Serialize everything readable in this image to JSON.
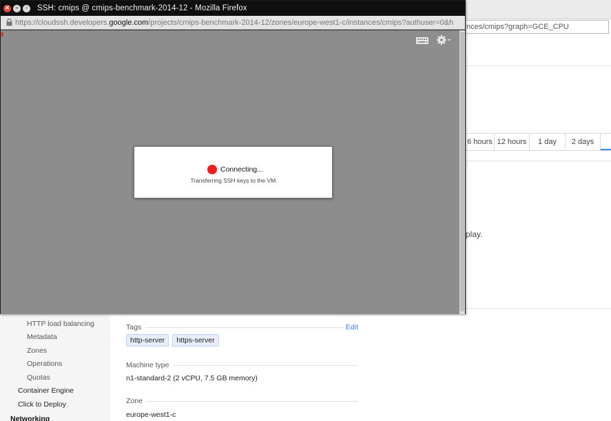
{
  "background": {
    "url_tail": "nces/cmips?graph=GCE_CPU",
    "time_tabs": [
      {
        "label": "6 hours",
        "w": 42
      },
      {
        "label": "12 hours",
        "w": 51
      },
      {
        "label": "1 day",
        "w": 52
      },
      {
        "label": "2 days",
        "w": 51
      },
      {
        "label": "",
        "w": 15
      }
    ],
    "tail_text": "play.",
    "sidebar": {
      "items": [
        "HTTP load balancing",
        "Metadata",
        "Zones",
        "Operations",
        "Quotas"
      ],
      "sections": [
        "Container Engine",
        "Click to Deploy"
      ],
      "heading": "Networking"
    },
    "details": {
      "tags": {
        "label": "Tags",
        "edit": "Edit",
        "chips": [
          "http-server",
          "https-server"
        ]
      },
      "machine_type": {
        "label": "Machine type",
        "value": "n1-standard-2 (2 vCPU, 7.5 GB memory)"
      },
      "zone": {
        "label": "Zone",
        "value": "europe-west1-c"
      }
    }
  },
  "popup": {
    "title": "SSH: cmips @ cmips-benchmark-2014-12 - Mozilla Firefox",
    "url_prefix": "https://cloudssh.developers.",
    "url_domain": "google.com",
    "url_path": "/projects/cmips-benchmark-2014-12/zones/europe-west1-c/instances/cmips?authuser=0&h",
    "dialog": {
      "status": "Connecting...",
      "detail": "Transferring SSH keys to the VM."
    }
  },
  "colors": {
    "terminal_bg": "#8d8d8d",
    "status_dot": "#f21d1d",
    "link": "#3b78e7"
  }
}
